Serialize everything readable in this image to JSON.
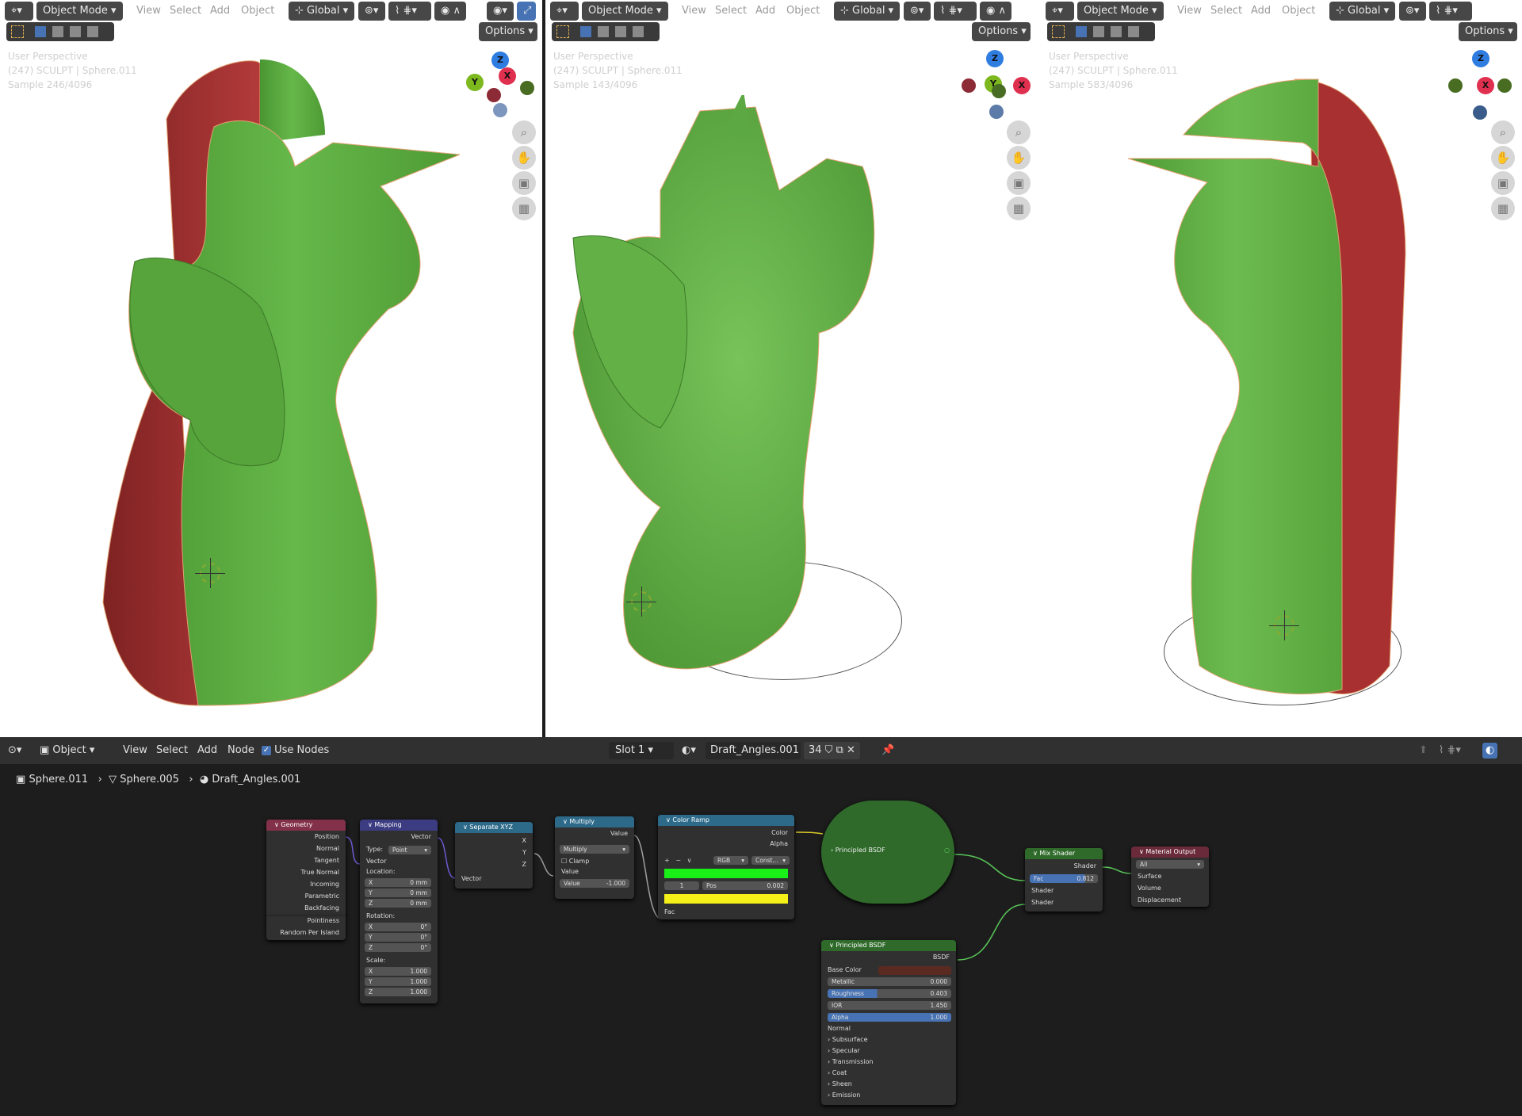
{
  "colors": {
    "green": "#5aab3e",
    "red": "#a83030",
    "viewport_bg": "#ffffff",
    "editor_bg": "#1d1d1d"
  },
  "viewports": [
    {
      "mode": "Object Mode",
      "menus": [
        "View",
        "Select",
        "Add",
        "Object"
      ],
      "orientation": "Global",
      "options": "Options",
      "overlay": [
        "User Perspective",
        "(247) SCULPT | Sphere.011",
        "Sample 246/4096"
      ]
    },
    {
      "mode": "Object Mode",
      "menus": [
        "View",
        "Select",
        "Add",
        "Object"
      ],
      "orientation": "Global",
      "options": "Options",
      "overlay": [
        "User Perspective",
        "(247) SCULPT | Sphere.011",
        "Sample 143/4096"
      ]
    },
    {
      "mode": "Object Mode",
      "menus": [
        "View",
        "Select",
        "Add",
        "Object"
      ],
      "orientation": "Global",
      "options": "Options",
      "overlay": [
        "User Perspective",
        "(247) SCULPT | Sphere.011",
        "Sample 583/4096"
      ]
    }
  ],
  "gizmo": {
    "z": "Z",
    "y": "Y",
    "x": "X"
  },
  "node_header": {
    "type": "Object",
    "menus": [
      "View",
      "Select",
      "Add",
      "Node"
    ],
    "use_nodes": "Use Nodes",
    "slot": "Slot 1",
    "material": "Draft_Angles.001",
    "users": "34"
  },
  "breadcrumb": [
    "Sphere.011",
    "Sphere.005",
    "Draft_Angles.001"
  ],
  "nodes": {
    "geometry": {
      "title": "Geometry",
      "outputs": [
        "Position",
        "Normal",
        "Tangent",
        "True Normal",
        "Incoming",
        "Parametric",
        "Backfacing",
        "Pointiness",
        "Random Per Island"
      ]
    },
    "mapping": {
      "title": "Mapping",
      "output": "Vector",
      "type_label": "Type:",
      "type": "Point",
      "vector": "Vector",
      "location": "Location:",
      "loc": [
        "0 mm",
        "0 mm",
        "0 mm"
      ],
      "rotation": "Rotation:",
      "rot": [
        "0°",
        "0°",
        "0°"
      ],
      "scale": "Scale:",
      "scl": [
        "1.000",
        "1.000",
        "1.000"
      ],
      "axes": [
        "X",
        "Y",
        "Z"
      ]
    },
    "separate": {
      "title": "Separate XYZ",
      "outputs": [
        "X",
        "Y",
        "Z"
      ],
      "input": "Vector"
    },
    "multiply": {
      "title": "Multiply",
      "output": "Value",
      "op": "Multiply",
      "clamp": "Clamp",
      "input": "Value",
      "value_label": "Value",
      "value": "-1.000"
    },
    "colorramp": {
      "title": "Color Ramp",
      "outputs": [
        "Color",
        "Alpha"
      ],
      "mode": "RGB",
      "interp": "Const...",
      "index": "1",
      "pos_label": "Pos",
      "pos": "0.002",
      "input": "Fac"
    },
    "principled_collapsed": {
      "title": "Principled BSDF"
    },
    "principled": {
      "title": "Principled BSDF",
      "output": "BSDF",
      "base_color": "Base Color",
      "fields": [
        [
          "Metallic",
          "0.000"
        ],
        [
          "Roughness",
          "0.403"
        ],
        [
          "IOR",
          "1.450"
        ],
        [
          "Alpha",
          "1.000"
        ]
      ],
      "normal": "Normal",
      "panels": [
        "Subsurface",
        "Specular",
        "Transmission",
        "Coat",
        "Sheen",
        "Emission"
      ]
    },
    "mix": {
      "title": "Mix Shader",
      "output": "Shader",
      "fac_label": "Fac",
      "fac": "0.812",
      "inputs": [
        "Shader",
        "Shader"
      ]
    },
    "output": {
      "title": "Material Output",
      "target": "All",
      "inputs": [
        "Surface",
        "Volume",
        "Displacement"
      ]
    }
  }
}
